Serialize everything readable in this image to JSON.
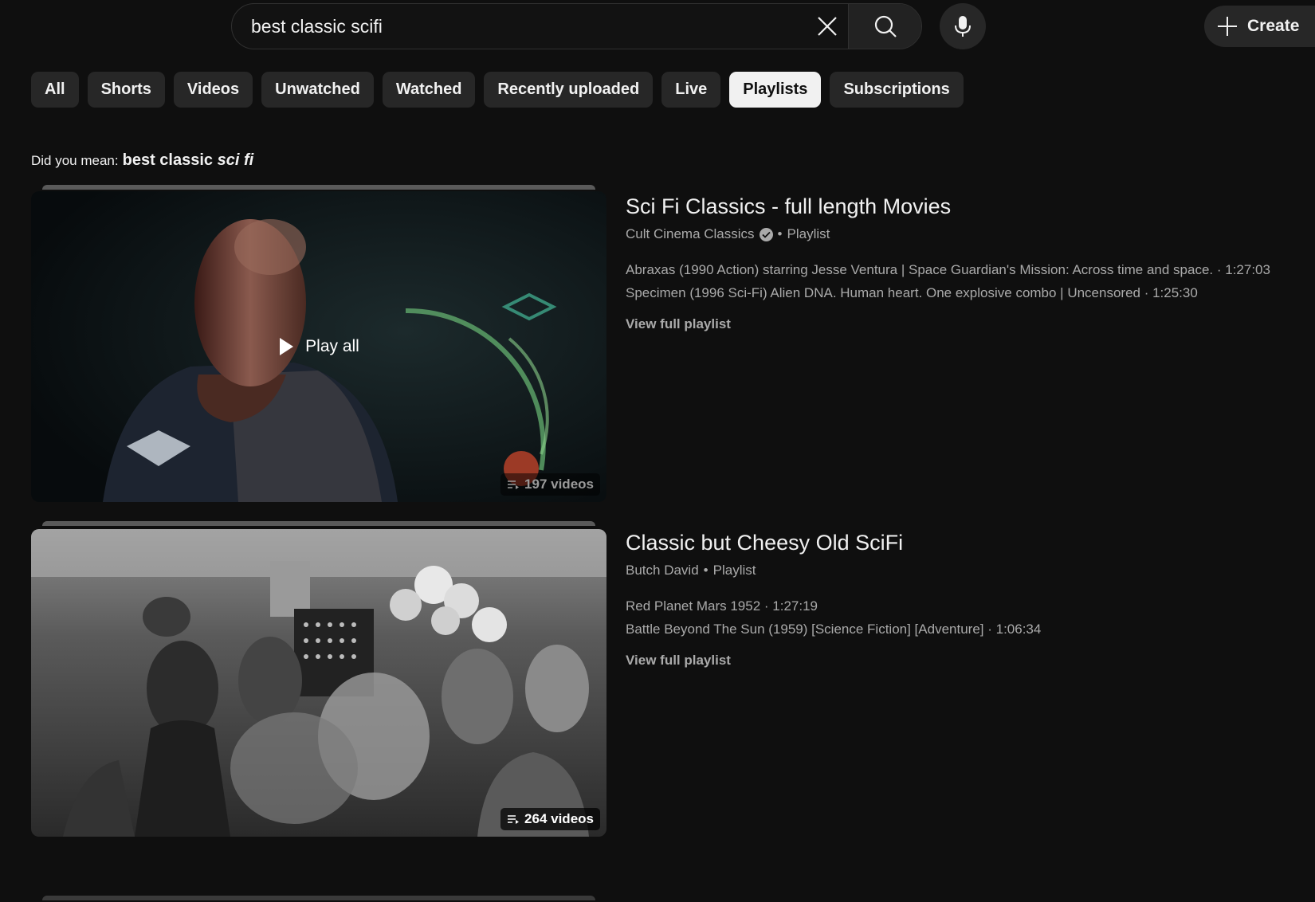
{
  "search": {
    "query": "best classic scifi",
    "clear_icon": "close-icon",
    "search_icon": "search-icon",
    "mic_icon": "microphone-icon"
  },
  "header": {
    "create_label": "Create",
    "create_icon": "plus-icon"
  },
  "chips": [
    {
      "label": "All",
      "active": false
    },
    {
      "label": "Shorts",
      "active": false
    },
    {
      "label": "Videos",
      "active": false
    },
    {
      "label": "Unwatched",
      "active": false
    },
    {
      "label": "Watched",
      "active": false
    },
    {
      "label": "Recently uploaded",
      "active": false
    },
    {
      "label": "Live",
      "active": false
    },
    {
      "label": "Playlists",
      "active": true
    },
    {
      "label": "Subscriptions",
      "active": false
    }
  ],
  "did_you_mean": {
    "prefix": "Did you mean:",
    "plain": "best classic",
    "italic": "sci fi"
  },
  "results": [
    {
      "title": "Sci Fi Classics - full length Movies",
      "channel": "Cult Cinema Classics",
      "verified": true,
      "type": "Playlist",
      "videos": [
        "Abraxas (1990 Action) starring Jesse Ventura | Space Guardian's Mission: Across time and space. · 1:27:03",
        "Specimen (1996 Sci-Fi) Alien DNA. Human heart. One explosive combo | Uncensored · 1:25:30"
      ],
      "view_full": "View full playlist",
      "count": "197 videos",
      "play_all": "Play all"
    },
    {
      "title": "Classic but Cheesy Old SciFi",
      "channel": "Butch David",
      "verified": false,
      "type": "Playlist",
      "videos": [
        "Red Planet Mars 1952 · 1:27:19",
        "Battle Beyond The Sun (1959) [Science Fiction] [Adventure] · 1:06:34"
      ],
      "view_full": "View full playlist",
      "count": "264 videos"
    }
  ]
}
